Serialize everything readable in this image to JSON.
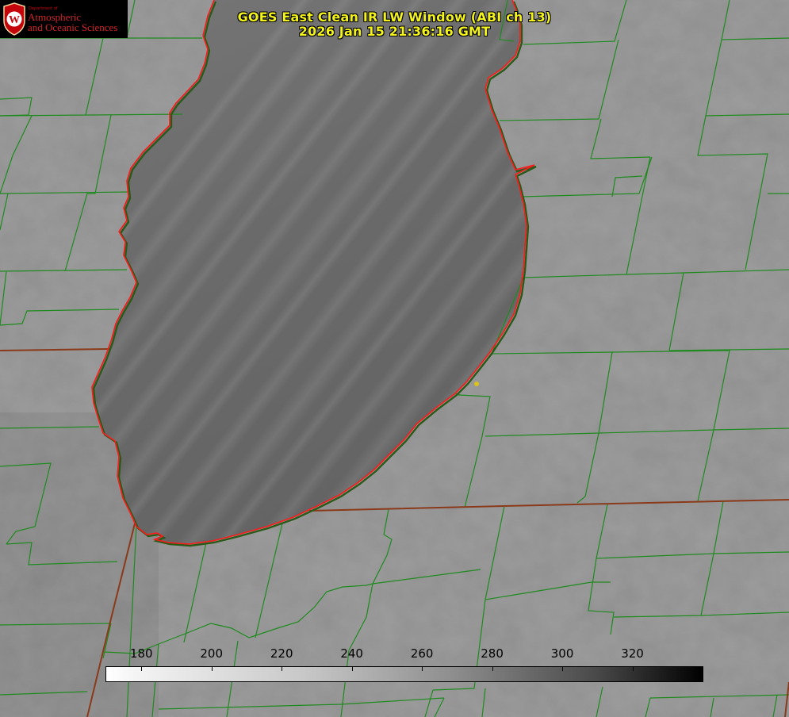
{
  "header": {
    "title": "GOES East Clean IR LW Window (ABI ch 13)",
    "timestamp": "2026 Jan 15 21:36:16 GMT"
  },
  "logo": {
    "department": "Department of",
    "line1": "Atmospheric",
    "line2": "and Oceanic Sciences",
    "seal_icon": "uw-crest-icon",
    "seal_letter": "W",
    "brand_color": "#c5050c"
  },
  "colorbar": {
    "ticks": [
      "180",
      "200",
      "220",
      "240",
      "260",
      "280",
      "300",
      "320"
    ],
    "range": [
      170,
      340
    ],
    "palette": "white-to-black"
  },
  "colors": {
    "county_lines": "#1f8a1f",
    "state_lines": "#8a3a1a",
    "coastline_red": "#ff1a1a",
    "marker": "#d9c21a"
  }
}
